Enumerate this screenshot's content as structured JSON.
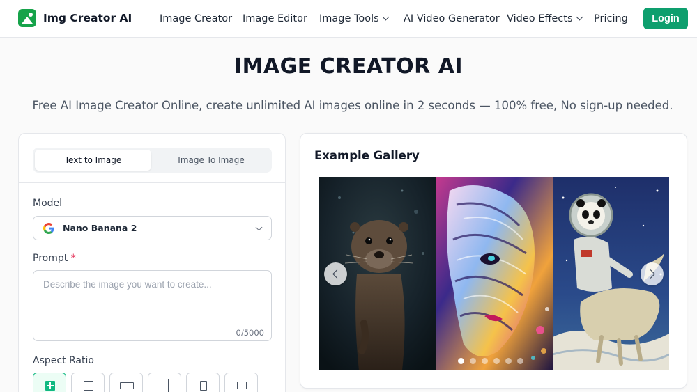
{
  "header": {
    "brand": "Img Creator AI",
    "nav": [
      {
        "label": "Image Creator",
        "has_dropdown": false
      },
      {
        "label": "Image Editor",
        "has_dropdown": false
      },
      {
        "label": "Image Tools",
        "has_dropdown": true
      },
      {
        "label": "AI Video Generator",
        "has_dropdown": false
      },
      {
        "label": "Video Effects",
        "has_dropdown": true
      },
      {
        "label": "Pricing",
        "has_dropdown": false
      }
    ],
    "login_label": "Login"
  },
  "hero": {
    "title": "IMAGE CREATOR AI",
    "subtitle": "Free AI Image Creator Online, create unlimited AI images online in 2 seconds — 100% free, No sign-up needed."
  },
  "form": {
    "tabs": [
      {
        "label": "Text to Image",
        "active": true
      },
      {
        "label": "Image To Image",
        "active": false
      }
    ],
    "model_label": "Model",
    "model_value": "Nano Banana 2",
    "model_icon": "google-icon",
    "prompt_label": "Prompt",
    "prompt_required_mark": "*",
    "prompt_placeholder": "Describe the image you want to create...",
    "prompt_value": "",
    "char_count": "0/5000",
    "aspect_label": "Aspect Ratio",
    "aspect_options": [
      {
        "icon": "auto-ratio-icon",
        "selected": true
      },
      {
        "icon": "square-ratio-icon",
        "selected": false
      },
      {
        "icon": "wide-ratio-icon",
        "selected": false
      },
      {
        "icon": "portrait-ratio-icon",
        "selected": false
      },
      {
        "icon": "tall-ratio-icon",
        "selected": false
      },
      {
        "icon": "landscape-ratio-icon",
        "selected": false
      }
    ]
  },
  "gallery": {
    "title": "Example Gallery",
    "images": [
      "otter-underwater",
      "psychedelic-face",
      "astronaut-panda-on-horse"
    ],
    "slide_count": 6,
    "active_slide": 1
  },
  "colors": {
    "brand": "#16a34a",
    "login_bg": "#0e9f6e",
    "required": "#e11d48",
    "selected_ratio": "#10b981"
  }
}
